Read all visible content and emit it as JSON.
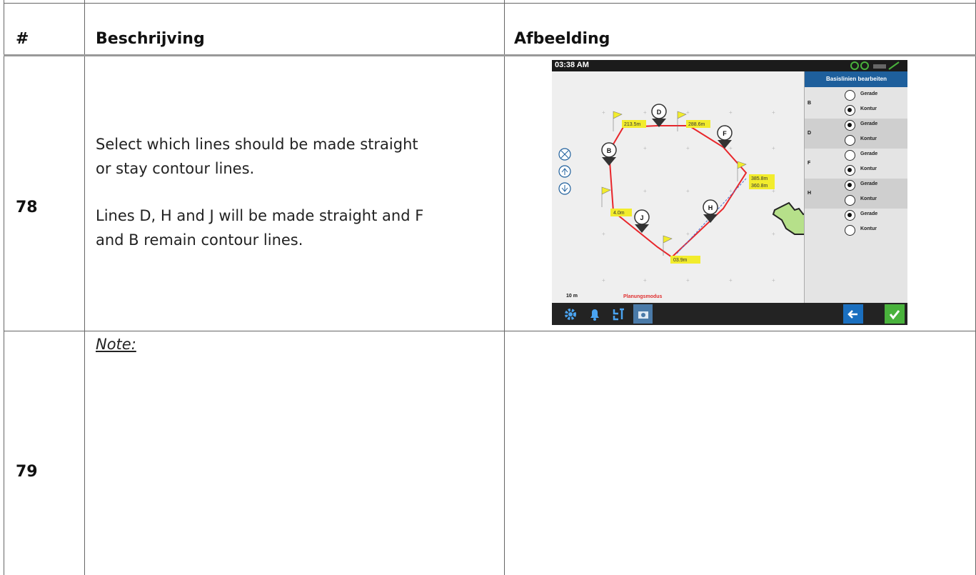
{
  "table": {
    "headers": {
      "number": "#",
      "description": "Beschrijving",
      "image": "Afbeelding"
    },
    "rows": [
      {
        "number": "78",
        "description_paragraphs": [
          "Select which lines should be made straight",
          "or stay contour lines.",
          "Lines D, H and J will be made straight and F",
          "and B remain contour lines."
        ]
      },
      {
        "number": "79",
        "note": "Note:"
      }
    ]
  },
  "screen": {
    "clock": "03:38 AM",
    "panel_title": "Basislinien bearbeiten",
    "mode": "Planungsmodus",
    "scale": "10 m",
    "options": {
      "straight": "Gerade",
      "contour": "Kontur"
    },
    "groups": [
      {
        "letter": "B",
        "selected": "Kontur"
      },
      {
        "letter": "D",
        "selected": "Gerade"
      },
      {
        "letter": "F",
        "selected": "Kontur"
      },
      {
        "letter": "H",
        "selected": "Gerade"
      },
      {
        "letter": "",
        "selected": "Gerade"
      }
    ],
    "markers": [
      "D",
      "F",
      "B",
      "J",
      "H"
    ],
    "measurements": [
      "213.5m",
      "288.6m",
      "385.8m",
      "360.8m",
      "4.0m",
      "03.9m"
    ],
    "colors": {
      "boundary": "#e8262b",
      "flag": "#f2ec2c",
      "panel_header": "#1e5f9c",
      "confirm": "#49b23c",
      "back": "#1a6fbf",
      "mode_text": "#e03030"
    },
    "icons": [
      "gear-icon",
      "bell-icon",
      "tool-icon",
      "camera-icon",
      "back-arrow-icon",
      "checkmark-icon",
      "pointing-hand-icon",
      "zoom-extents-icon",
      "zoom-in-icon",
      "zoom-out-icon"
    ]
  }
}
